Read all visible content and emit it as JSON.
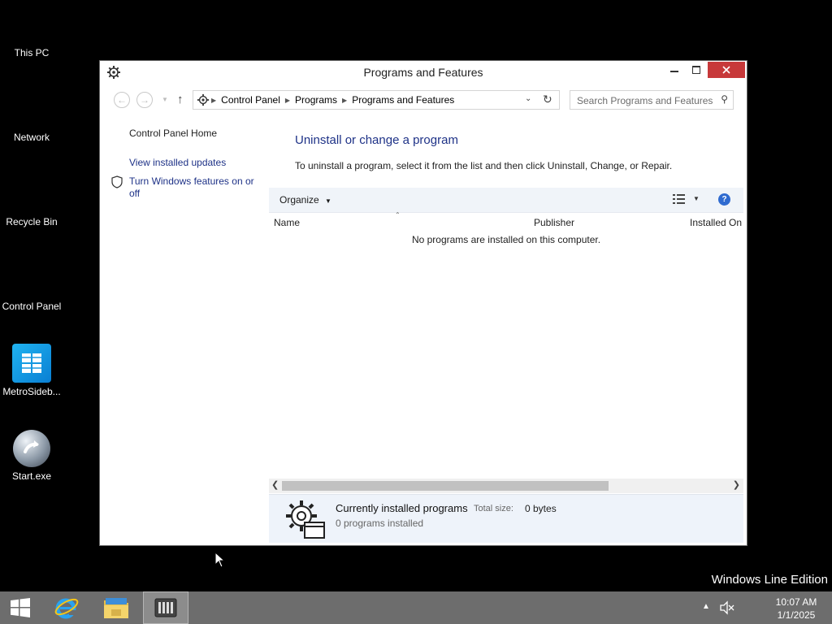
{
  "desktop": {
    "icons": [
      {
        "label": "This PC"
      },
      {
        "label": "Network"
      },
      {
        "label": "Recycle Bin"
      },
      {
        "label": "Control Panel"
      },
      {
        "label": "MetroSideb..."
      },
      {
        "label": "Start.exe"
      }
    ],
    "watermark": "Windows Line Edition"
  },
  "window": {
    "title": "Programs and Features",
    "close_color": "#c7393a",
    "address": {
      "breadcrumbs": [
        "Control Panel",
        "Programs",
        "Programs and Features"
      ]
    },
    "search": {
      "placeholder": "Search Programs and Features"
    },
    "left_pane": {
      "home_link": "Control Panel Home",
      "links": [
        "View installed updates",
        "Turn Windows features on or off"
      ]
    },
    "main": {
      "heading": "Uninstall or change a program",
      "description": "To uninstall a program, select it from the list and then click Uninstall, Change, or Repair.",
      "organize_label": "Organize",
      "columns": [
        "Name",
        "Publisher",
        "Installed On"
      ],
      "empty_message": "No programs are installed on this computer."
    },
    "details": {
      "title": "Currently installed programs",
      "total_size_label": "Total size:",
      "total_size_value": "0 bytes",
      "count_text": "0 programs installed"
    },
    "link_color": "#1e3287"
  },
  "taskbar": {
    "time": "10:07 AM",
    "date": "1/1/2025",
    "items": [
      "start-icon",
      "internet-explorer-icon",
      "file-explorer-icon",
      "control-panel-icon"
    ]
  }
}
